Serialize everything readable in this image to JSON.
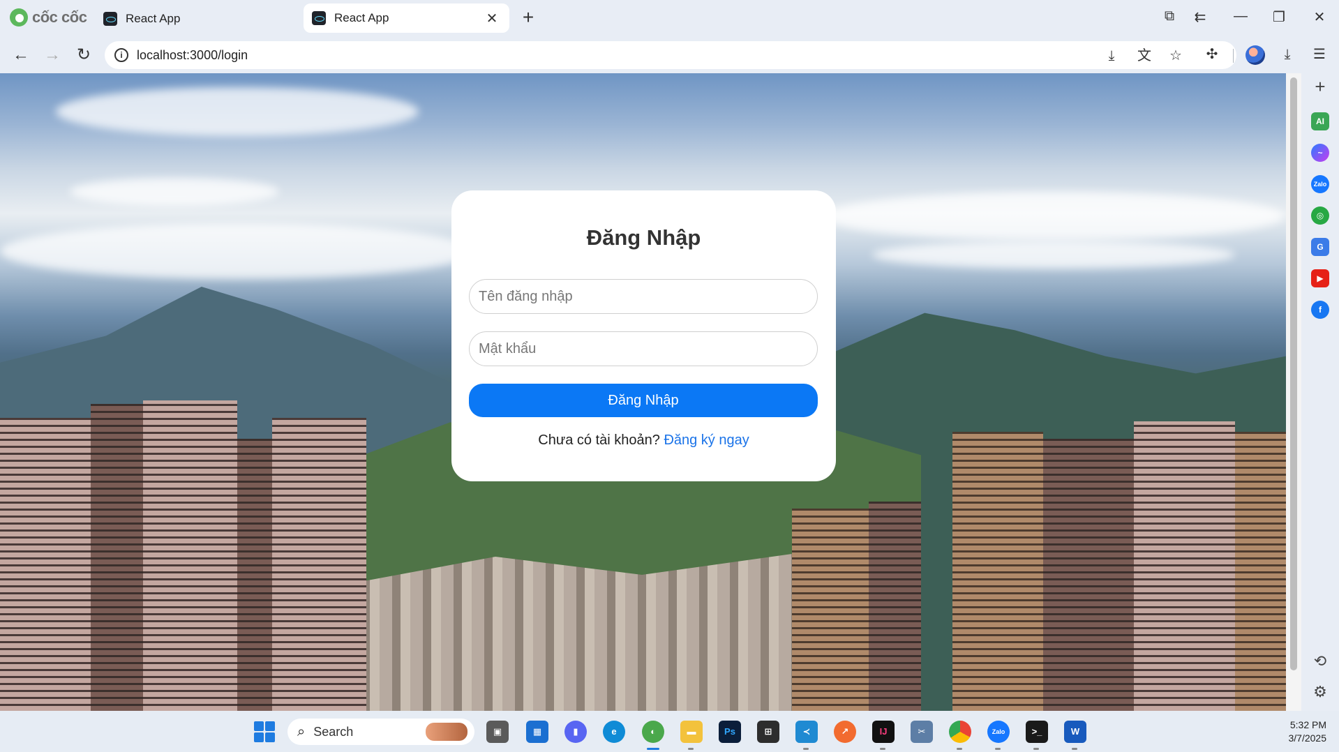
{
  "browser": {
    "brand": "cốc cốc",
    "tabs": [
      {
        "title": "React App",
        "active": false
      },
      {
        "title": "React App",
        "active": true
      }
    ],
    "new_tab_icon": "plus-icon",
    "url": "localhost:3000/login"
  },
  "login": {
    "title": "Đăng Nhập",
    "username_placeholder": "Tên đăng nhập",
    "password_placeholder": "Mật khẩu",
    "submit_label": "Đăng Nhập",
    "signup_prompt": "Chưa có tài khoản?",
    "signup_link": "Đăng ký ngay"
  },
  "sidepanel": {
    "items": [
      "ai-icon",
      "messenger-icon",
      "zalo-icon",
      "games-icon",
      "translate-icon",
      "youtube-icon",
      "facebook-icon",
      "history-icon",
      "settings-icon"
    ]
  },
  "taskbar": {
    "search_label": "Search",
    "time": "5:32 PM",
    "date": "3/7/2025"
  },
  "colors": {
    "primary_button": "#0b78f5",
    "link": "#1a73e8"
  }
}
